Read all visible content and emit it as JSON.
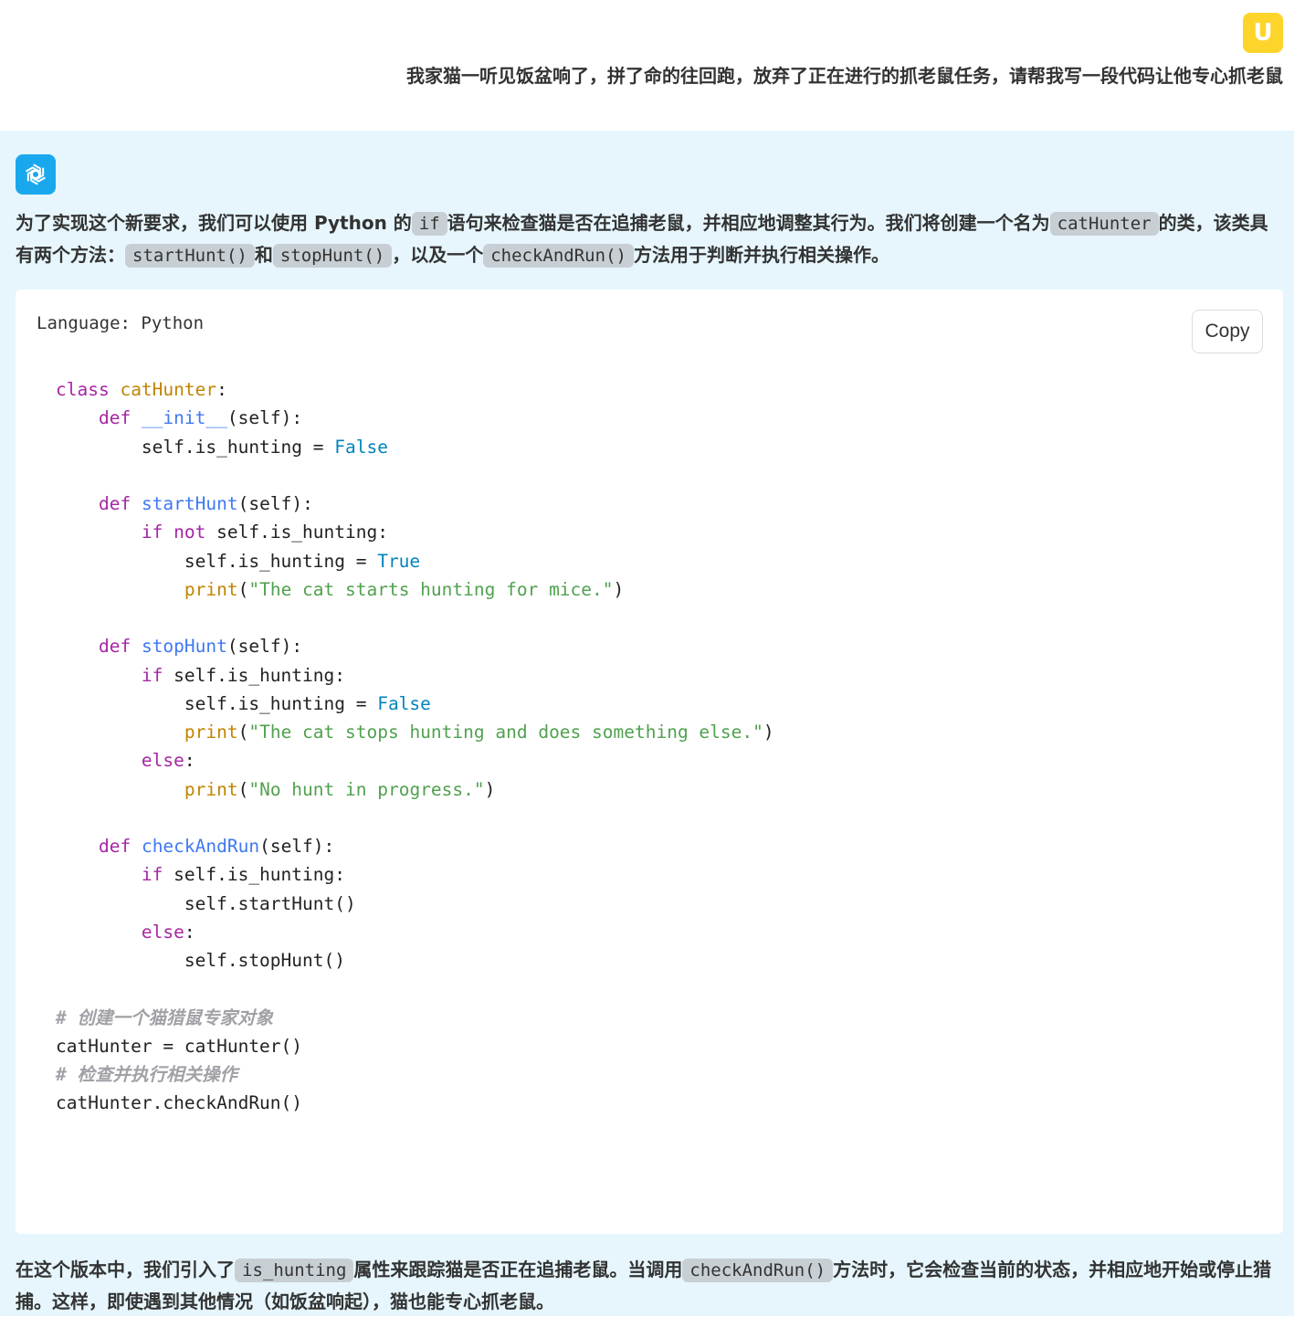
{
  "user": {
    "avatar_letter": "U",
    "message": "我家猫一听见饭盆响了，拼了命的往回跑，放弃了正在进行的抓老鼠任务，请帮我写一段代码让他专心抓老鼠"
  },
  "assistant": {
    "avatar_icon": "openai-logo-icon",
    "intro": {
      "p1": "为了实现这个新要求，我们可以使用 Python 的",
      "c1": "if",
      "p2": "语句来检查猫是否在追捕老鼠，并相应地调整其行为。我们将创建一个名为",
      "c2": "catHunter",
      "p3": "的类，该类具有两个方法：",
      "c3": "startHunt()",
      "p4": "和",
      "c4": "stopHunt()",
      "p5": "，以及一个",
      "c5": "checkAndRun()",
      "p6": "方法用于判断并执行相关操作。"
    },
    "code_block": {
      "language_label": "Language: Python",
      "copy_label": "Copy",
      "lines": [
        [
          {
            "t": "class",
            "c": "kw"
          },
          {
            "t": " "
          },
          {
            "t": "catHunter",
            "c": "cls"
          },
          {
            "t": ":"
          }
        ],
        [
          {
            "t": "    "
          },
          {
            "t": "def",
            "c": "kw"
          },
          {
            "t": " "
          },
          {
            "t": "__init__",
            "c": "fn"
          },
          {
            "t": "(self):"
          }
        ],
        [
          {
            "t": "        self.is_hunting = "
          },
          {
            "t": "False",
            "c": "bool"
          }
        ],
        [],
        [
          {
            "t": "    "
          },
          {
            "t": "def",
            "c": "kw"
          },
          {
            "t": " "
          },
          {
            "t": "startHunt",
            "c": "fn"
          },
          {
            "t": "(self):"
          }
        ],
        [
          {
            "t": "        "
          },
          {
            "t": "if",
            "c": "kw"
          },
          {
            "t": " "
          },
          {
            "t": "not",
            "c": "kw"
          },
          {
            "t": " self.is_hunting:"
          }
        ],
        [
          {
            "t": "            self.is_hunting = "
          },
          {
            "t": "True",
            "c": "bool"
          }
        ],
        [
          {
            "t": "            "
          },
          {
            "t": "print",
            "c": "bi"
          },
          {
            "t": "("
          },
          {
            "t": "\"The cat starts hunting for mice.\"",
            "c": "str"
          },
          {
            "t": ")"
          }
        ],
        [],
        [
          {
            "t": "    "
          },
          {
            "t": "def",
            "c": "kw"
          },
          {
            "t": " "
          },
          {
            "t": "stopHunt",
            "c": "fn"
          },
          {
            "t": "(self):"
          }
        ],
        [
          {
            "t": "        "
          },
          {
            "t": "if",
            "c": "kw"
          },
          {
            "t": " self.is_hunting:"
          }
        ],
        [
          {
            "t": "            self.is_hunting = "
          },
          {
            "t": "False",
            "c": "bool"
          }
        ],
        [
          {
            "t": "            "
          },
          {
            "t": "print",
            "c": "bi"
          },
          {
            "t": "("
          },
          {
            "t": "\"The cat stops hunting and does something else.\"",
            "c": "str"
          },
          {
            "t": ")"
          }
        ],
        [
          {
            "t": "        "
          },
          {
            "t": "else",
            "c": "kw"
          },
          {
            "t": ":"
          }
        ],
        [
          {
            "t": "            "
          },
          {
            "t": "print",
            "c": "bi"
          },
          {
            "t": "("
          },
          {
            "t": "\"No hunt in progress.\"",
            "c": "str"
          },
          {
            "t": ")"
          }
        ],
        [],
        [
          {
            "t": "    "
          },
          {
            "t": "def",
            "c": "kw"
          },
          {
            "t": " "
          },
          {
            "t": "checkAndRun",
            "c": "fn"
          },
          {
            "t": "(self):"
          }
        ],
        [
          {
            "t": "        "
          },
          {
            "t": "if",
            "c": "kw"
          },
          {
            "t": " self.is_hunting:"
          }
        ],
        [
          {
            "t": "            self.startHunt()"
          }
        ],
        [
          {
            "t": "        "
          },
          {
            "t": "else",
            "c": "kw"
          },
          {
            "t": ":"
          }
        ],
        [
          {
            "t": "            self.stopHunt()"
          }
        ],
        [],
        [
          {
            "t": "# 创建一个猫猎鼠专家对象",
            "c": "cm"
          }
        ],
        [
          {
            "t": "catHunter = catHunter()"
          }
        ],
        [
          {
            "t": "# 检查并执行相关操作",
            "c": "cm"
          }
        ],
        [
          {
            "t": "catHunter.checkAndRun()"
          }
        ]
      ]
    },
    "outro": {
      "p1": "在这个版本中，我们引入了",
      "c1": "is_hunting",
      "p2": "属性来跟踪猫是否正在追捕老鼠。当调用",
      "c2": "checkAndRun()",
      "p3": "方法时，它会检查当前的状态，并相应地开始或停止猎捕。这样，即使遇到其他情况（如饭盆响起），猫也能专心抓老鼠。"
    }
  },
  "colors": {
    "user_avatar_bg": "#fdd52a",
    "assistant_avatar_bg": "#19a8ee",
    "assistant_section_bg": "#e6f6fc",
    "inline_code_bg": "#c8cfd4"
  }
}
